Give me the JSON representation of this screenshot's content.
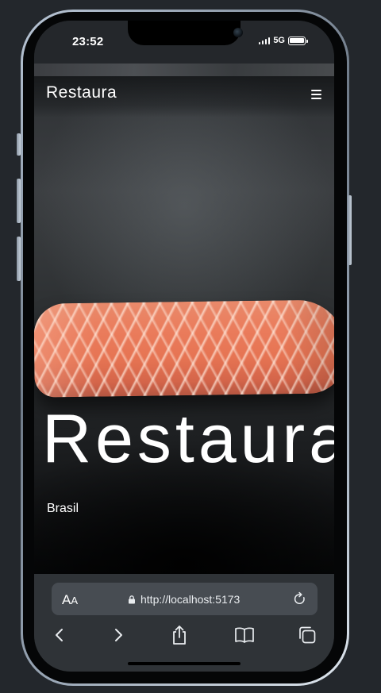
{
  "status_bar": {
    "time": "23:52",
    "network": "5G",
    "battery_level": 1.0,
    "signal_bars": 4
  },
  "site": {
    "logo": "Restaura",
    "hero_title": "Restaura",
    "hero_subtitle": "Brasil"
  },
  "browser": {
    "text_size_label_large": "A",
    "text_size_label_small": "A",
    "url": "http://localhost:5173"
  },
  "colors": {
    "background": "#23272c",
    "browser_bar": "#2f3337",
    "url_bar": "#474c52",
    "salmon": "#e67453"
  },
  "icons": {
    "menu": "hamburger-menu-icon",
    "lock": "lock-icon",
    "reload": "reload-icon",
    "back": "chevron-left-icon",
    "forward": "chevron-right-icon",
    "share": "share-icon",
    "bookmarks": "book-icon",
    "tabs": "tabs-icon"
  }
}
